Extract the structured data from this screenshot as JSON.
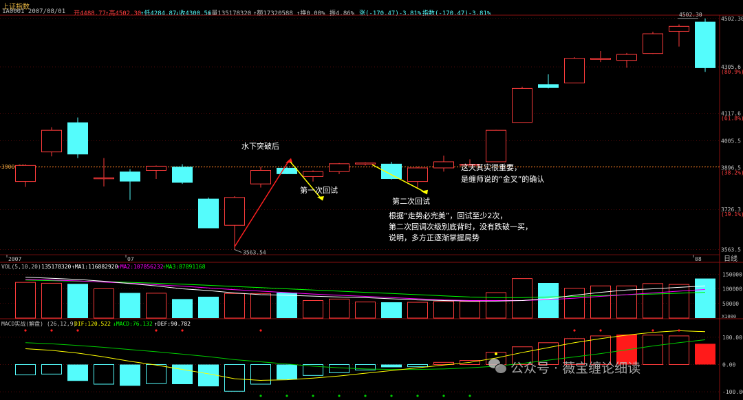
{
  "header": {
    "title": "上证指数",
    "code_date": "1A0001 2007/08/01",
    "open": "开4488.77",
    "high": "↑高4502.30",
    "low": "↑低4284.87",
    "close": "↓收4300.56",
    "volume": "↓量135178320",
    "amount": "↑额17320588",
    "turnover": "↑换0.00%",
    "amplitude": "振4.86%",
    "change": "涨(-170.47)-3.81%",
    "index": "指数(-170.47)-3.81%"
  },
  "colors": {
    "up": "#ff3c3c",
    "down": "#54fcfc",
    "grid": "#8a1010",
    "header_red": "#ff4040",
    "label_yellow": "#ffff00",
    "ma5": "#ffffff",
    "ma10": "#ff00ff",
    "ma20": "#00ff00",
    "macd_dif": "#ffff00",
    "macd_dea": "#00cc00",
    "arrow_red": "#ff2020",
    "arrow_yellow": "#ffff00"
  },
  "price_axis": {
    "ticks": [
      "4502.30",
      "4305.6",
      "(80.9%)",
      "4117.6",
      "(61.8%)",
      "4005.5",
      "3896.5",
      "(38.2%)",
      "3726.3",
      "(19.1%)",
      "3563.5"
    ],
    "ref_line_label": "3900.00",
    "max_label": "4502.30",
    "min_label": "3563.54"
  },
  "date_axis": {
    "labels": [
      "2007",
      "07",
      "08"
    ],
    "period": "日线"
  },
  "vol_panel": {
    "title": "VOL(5,10,20)",
    "value": "135178320",
    "ma1": "↑MA1:116882920",
    "ma2": "↑MA2:107856232",
    "ma3": "↑MA3:87891168",
    "ticks": [
      "150000",
      "100000",
      "50000"
    ],
    "unit": "X1000"
  },
  "macd_panel": {
    "title": "MACD实战(解盘)",
    "params": "(26,12,9)",
    "dif": "DIF:120.522",
    "macd": "↓MACD:76.132",
    "dea": "↑DEF:90.782",
    "ticks": [
      "100.00",
      "0.00",
      "-100.00"
    ]
  },
  "annotations": {
    "breakout": "水下突破后",
    "first_test": "第一次回试",
    "second_test": "第二次回试",
    "important_1": "这天其实很重要，",
    "important_2": "是缠师说的“金叉”的确认",
    "note_1": "根据“走势必完美”，回试至少2次，",
    "note_2": "第二次回调次级别底背时，没有跌破一买，",
    "note_3": "说明，多方正逐渐掌握局势"
  },
  "watermark": "公众号 · 薇宝缠论细读",
  "chart_data": [
    {
      "type": "candlestick",
      "title": "上证指数",
      "candles": [
        {
          "o": 3840,
          "h": 3910,
          "l": 3818,
          "c": 3905
        },
        {
          "o": 3960,
          "h": 4060,
          "l": 3942,
          "c": 4048
        },
        {
          "o": 4080,
          "h": 4100,
          "l": 3935,
          "c": 3950
        },
        {
          "o": 3855,
          "h": 3935,
          "l": 3820,
          "c": 3855
        },
        {
          "o": 3880,
          "h": 3890,
          "l": 3765,
          "c": 3840
        },
        {
          "o": 3885,
          "h": 3905,
          "l": 3850,
          "c": 3902
        },
        {
          "o": 3900,
          "h": 3910,
          "l": 3830,
          "c": 3835
        },
        {
          "o": 3770,
          "h": 3775,
          "l": 3650,
          "c": 3650
        },
        {
          "o": 3662,
          "h": 3780,
          "l": 3563.54,
          "c": 3775
        },
        {
          "o": 3830,
          "h": 3900,
          "l": 3815,
          "c": 3885
        },
        {
          "o": 3895,
          "h": 3900,
          "l": 3870,
          "c": 3870
        },
        {
          "o": 3860,
          "h": 3885,
          "l": 3840,
          "c": 3880
        },
        {
          "o": 3880,
          "h": 3915,
          "l": 3870,
          "c": 3912
        },
        {
          "o": 3912,
          "h": 3918,
          "l": 3905,
          "c": 3915
        },
        {
          "o": 3912,
          "h": 3920,
          "l": 3848,
          "c": 3850
        },
        {
          "o": 3840,
          "h": 3900,
          "l": 3815,
          "c": 3895
        },
        {
          "o": 3895,
          "h": 3945,
          "l": 3880,
          "c": 3920
        },
        {
          "o": 3910,
          "h": 3930,
          "l": 3905,
          "c": 3910
        },
        {
          "o": 3920,
          "h": 4050,
          "l": 3920,
          "c": 4048
        },
        {
          "o": 4080,
          "h": 4225,
          "l": 4080,
          "c": 4218
        },
        {
          "o": 4235,
          "h": 4275,
          "l": 4218,
          "c": 4220
        },
        {
          "o": 4240,
          "h": 4345,
          "l": 4240,
          "c": 4340
        },
        {
          "o": 4340,
          "h": 4370,
          "l": 4325,
          "c": 4340
        },
        {
          "o": 4332,
          "h": 4362,
          "l": 4302,
          "c": 4356
        },
        {
          "o": 4360,
          "h": 4448,
          "l": 4358,
          "c": 4440
        },
        {
          "o": 4450,
          "h": 4478,
          "l": 4388,
          "c": 4470
        },
        {
          "o": 4488.77,
          "h": 4502.3,
          "l": 4284.87,
          "c": 4300.56
        }
      ],
      "ref_line": 3900.0,
      "ylim": [
        3548,
        4510
      ]
    },
    {
      "type": "bar",
      "title": "VOL(5,10,20)",
      "values": [
        122000,
        119000,
        117000,
        100000,
        86000,
        85000,
        65000,
        73000,
        84000,
        84000,
        87000,
        60000,
        65000,
        55000,
        54000,
        54000,
        57000,
        57000,
        87000,
        135000,
        120000,
        102000,
        110000,
        110000,
        118000,
        115000,
        135178
      ],
      "ma5": [
        140000,
        136000,
        132000,
        126000,
        118000,
        110000,
        100000,
        94000,
        86000,
        80000,
        78000,
        75000,
        72000,
        70000,
        66000,
        62000,
        60000,
        58000,
        58000,
        60000,
        66000,
        78000,
        88000,
        96000,
        100000,
        105000,
        110000
      ],
      "ma10": [
        132000,
        130000,
        127000,
        123000,
        119000,
        114000,
        109000,
        103000,
        97000,
        92000,
        87000,
        82000,
        78000,
        74000,
        70000,
        66000,
        62000,
        60000,
        60000,
        60000,
        63000,
        68000,
        74000,
        80000,
        86000,
        92000,
        98000
      ],
      "ma20": [
        130000,
        128000,
        126000,
        124000,
        122000,
        119000,
        116000,
        112000,
        108000,
        104000,
        100000,
        96000,
        92000,
        88000,
        84000,
        80000,
        76000,
        72000,
        70000,
        70000,
        72000,
        74000,
        77000,
        80000,
        82000,
        85000,
        88000
      ],
      "ylim": [
        0,
        160000
      ]
    },
    {
      "type": "bar",
      "title": "MACD实战(解盘)",
      "macd": [
        -38,
        -35,
        -60,
        -72,
        -78,
        -70,
        -72,
        -80,
        -98,
        -72,
        -55,
        -40,
        -30,
        -20,
        -10,
        -8,
        8,
        15,
        45,
        65,
        80,
        95,
        105,
        110,
        108,
        105,
        76.132
      ],
      "dif": [
        58,
        52,
        42,
        28,
        12,
        -2,
        -18,
        -34,
        -52,
        -58,
        -56,
        -50,
        -42,
        -32,
        -22,
        -12,
        -2,
        8,
        24,
        44,
        62,
        80,
        95,
        108,
        118,
        124,
        120.522
      ],
      "dea": [
        80,
        76,
        70,
        63,
        55,
        47,
        38,
        29,
        18,
        10,
        2,
        -6,
        -12,
        -16,
        -18,
        -18,
        -16,
        -12,
        -6,
        4,
        16,
        28,
        40,
        54,
        68,
        80,
        90.782
      ],
      "ylim": [
        -120,
        130
      ]
    }
  ]
}
